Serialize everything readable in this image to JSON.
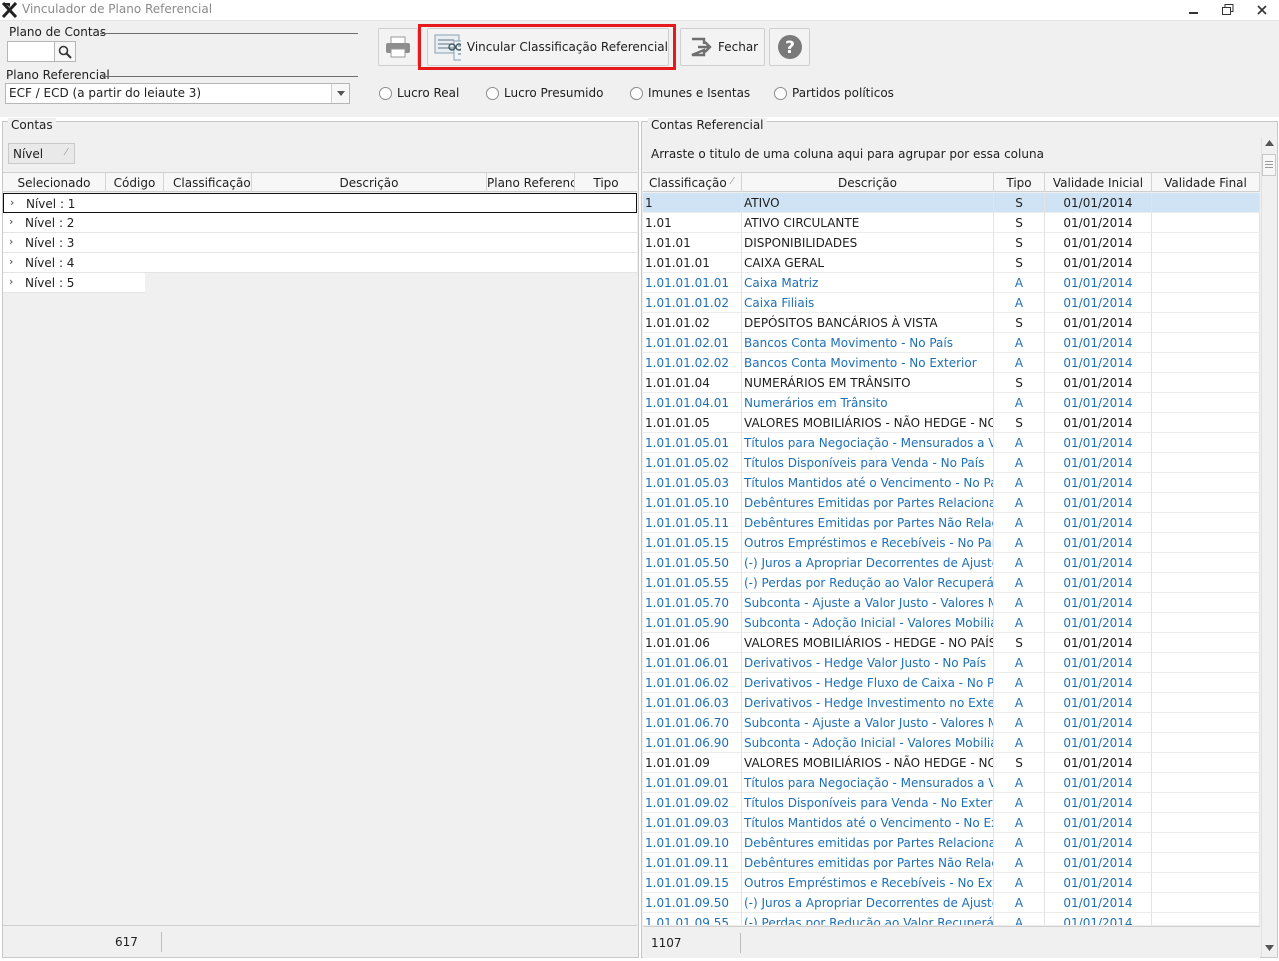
{
  "window": {
    "title": "Vinculador de Plano Referencial",
    "controls": [
      "minimize-icon",
      "restore-icon",
      "close-icon"
    ]
  },
  "top": {
    "plano_contas_label": "Plano de Contas",
    "plano_contas_value": "",
    "plano_referencial_label": "Plano Referencial",
    "plano_referencial_value": "ECF / ECD (a partir do leiaute 3)",
    "buttons": {
      "vincular": "Vincular Classificação Referencial",
      "fechar": "Fechar"
    },
    "radios": [
      "Lucro Real",
      "Lucro Presumido",
      "Imunes e Isentas",
      "Partidos políticos"
    ],
    "highlight_color": "#e51a1a"
  },
  "left": {
    "title": "Contas",
    "group_chip": "Nível",
    "columns": [
      "Selecionado",
      "Código",
      "Classificação",
      "Descrição",
      "Plano Referenci",
      "Tipo"
    ],
    "rows": [
      "Nível : 1",
      "Nível : 2",
      "Nível : 3",
      "Nível : 4",
      "Nível : 5"
    ],
    "footer_count": "617"
  },
  "right": {
    "title": "Contas Referencial",
    "group_hint": "Arraste o titulo de uma coluna aqui para agrupar por essa coluna",
    "columns": [
      "Classificação",
      "Descrição",
      "Tipo",
      "Validade Inicial",
      "Validade Final"
    ],
    "rows": [
      {
        "c": "1",
        "d": "ATIVO",
        "t": "S",
        "v": "01/01/2014",
        "f": ""
      },
      {
        "c": "1.01",
        "d": "ATIVO CIRCULANTE",
        "t": "S",
        "v": "01/01/2014",
        "f": ""
      },
      {
        "c": "1.01.01",
        "d": "DISPONIBILIDADES",
        "t": "S",
        "v": "01/01/2014",
        "f": ""
      },
      {
        "c": "1.01.01.01",
        "d": "CAIXA GERAL",
        "t": "S",
        "v": "01/01/2014",
        "f": ""
      },
      {
        "c": "1.01.01.01.01",
        "d": "Caixa Matriz",
        "t": "A",
        "v": "01/01/2014",
        "f": ""
      },
      {
        "c": "1.01.01.01.02",
        "d": "Caixa Filiais",
        "t": "A",
        "v": "01/01/2014",
        "f": ""
      },
      {
        "c": "1.01.01.02",
        "d": "DEPÓSITOS BANCÁRIOS À VISTA",
        "t": "S",
        "v": "01/01/2014",
        "f": ""
      },
      {
        "c": "1.01.01.02.01",
        "d": "Bancos Conta Movimento - No País",
        "t": "A",
        "v": "01/01/2014",
        "f": ""
      },
      {
        "c": "1.01.01.02.02",
        "d": "Bancos Conta Movimento - No Exterior",
        "t": "A",
        "v": "01/01/2014",
        "f": ""
      },
      {
        "c": "1.01.01.04",
        "d": "NUMERÁRIOS EM TRÂNSITO",
        "t": "S",
        "v": "01/01/2014",
        "f": ""
      },
      {
        "c": "1.01.01.04.01",
        "d": "Numerários em Trânsito",
        "t": "A",
        "v": "01/01/2014",
        "f": ""
      },
      {
        "c": "1.01.01.05",
        "d": "VALORES MOBILIÁRIOS - NÃO HEDGE - NO PA",
        "t": "S",
        "v": "01/01/2014",
        "f": ""
      },
      {
        "c": "1.01.01.05.01",
        "d": "Títulos para Negociação - Mensurados a Valor",
        "t": "A",
        "v": "01/01/2014",
        "f": ""
      },
      {
        "c": "1.01.01.05.02",
        "d": "Títulos Disponíveis para Venda - No País",
        "t": "A",
        "v": "01/01/2014",
        "f": ""
      },
      {
        "c": "1.01.01.05.03",
        "d": "Títulos Mantidos até o Vencimento - No País",
        "t": "A",
        "v": "01/01/2014",
        "f": ""
      },
      {
        "c": "1.01.01.05.10",
        "d": "Debêntures Emitidas por Partes Relacionadas -",
        "t": "A",
        "v": "01/01/2014",
        "f": ""
      },
      {
        "c": "1.01.01.05.11",
        "d": "Debêntures Emitidas por Partes Não Relacionad",
        "t": "A",
        "v": "01/01/2014",
        "f": ""
      },
      {
        "c": "1.01.01.05.15",
        "d": "Outros Empréstimos e Recebíveis - No País",
        "t": "A",
        "v": "01/01/2014",
        "f": ""
      },
      {
        "c": "1.01.01.05.50",
        "d": "(-) Juros a Apropriar Decorrentes de Ajuste a Va",
        "t": "A",
        "v": "01/01/2014",
        "f": ""
      },
      {
        "c": "1.01.01.05.55",
        "d": "(-) Perdas por Redução ao Valor Recuperável (I",
        "t": "A",
        "v": "01/01/2014",
        "f": ""
      },
      {
        "c": "1.01.01.05.70",
        "d": "Subconta - Ajuste a Valor Justo - Valores Mobil",
        "t": "A",
        "v": "01/01/2014",
        "f": ""
      },
      {
        "c": "1.01.01.05.90",
        "d": "Subconta - Adoção Inicial - Valores Mobiliários",
        "t": "A",
        "v": "01/01/2014",
        "f": ""
      },
      {
        "c": "1.01.01.06",
        "d": "VALORES MOBILIÁRIOS - HEDGE - NO PAÍS",
        "t": "S",
        "v": "01/01/2014",
        "f": ""
      },
      {
        "c": "1.01.01.06.01",
        "d": "Derivativos - Hedge Valor Justo - No País",
        "t": "A",
        "v": "01/01/2014",
        "f": ""
      },
      {
        "c": "1.01.01.06.02",
        "d": "Derivativos - Hedge Fluxo de Caixa - No País",
        "t": "A",
        "v": "01/01/2014",
        "f": ""
      },
      {
        "c": "1.01.01.06.03",
        "d": "Derivativos - Hedge Investimento no Exterior -",
        "t": "A",
        "v": "01/01/2014",
        "f": ""
      },
      {
        "c": "1.01.01.06.70",
        "d": "Subconta - Ajuste a Valor Justo - Valores Mobil",
        "t": "A",
        "v": "01/01/2014",
        "f": ""
      },
      {
        "c": "1.01.01.06.90",
        "d": "Subconta - Adoção Inicial - Valores Mobiliários",
        "t": "A",
        "v": "01/01/2014",
        "f": ""
      },
      {
        "c": "1.01.01.09",
        "d": "VALORES MOBILIÁRIOS - NÃO HEDGE - NO EX",
        "t": "S",
        "v": "01/01/2014",
        "f": ""
      },
      {
        "c": "1.01.01.09.01",
        "d": "Títulos para Negociação - Mensurados a Valor",
        "t": "A",
        "v": "01/01/2014",
        "f": ""
      },
      {
        "c": "1.01.01.09.02",
        "d": "Títulos Disponíveis para Venda - No Exterior",
        "t": "A",
        "v": "01/01/2014",
        "f": ""
      },
      {
        "c": "1.01.01.09.03",
        "d": "Títulos Mantidos até o Vencimento - No Exteri",
        "t": "A",
        "v": "01/01/2014",
        "f": ""
      },
      {
        "c": "1.01.01.09.10",
        "d": "Debêntures emitidas por Partes Relacionadas -",
        "t": "A",
        "v": "01/01/2014",
        "f": ""
      },
      {
        "c": "1.01.01.09.11",
        "d": "Debêntures emitidas por Partes Não Relacionad",
        "t": "A",
        "v": "01/01/2014",
        "f": ""
      },
      {
        "c": "1.01.01.09.15",
        "d": "Outros Empréstimos e Recebíveis - No Exterior",
        "t": "A",
        "v": "01/01/2014",
        "f": ""
      },
      {
        "c": "1.01.01.09.50",
        "d": "(-) Juros a Apropriar Decorrentes de Ajuste a Va",
        "t": "A",
        "v": "01/01/2014",
        "f": ""
      },
      {
        "c": "1.01.01.09.55",
        "d": "(-) Perdas por Redução ao Valor Recuperável (I",
        "t": "A",
        "v": "01/01/2014",
        "f": ""
      }
    ],
    "footer_count": "1107"
  }
}
